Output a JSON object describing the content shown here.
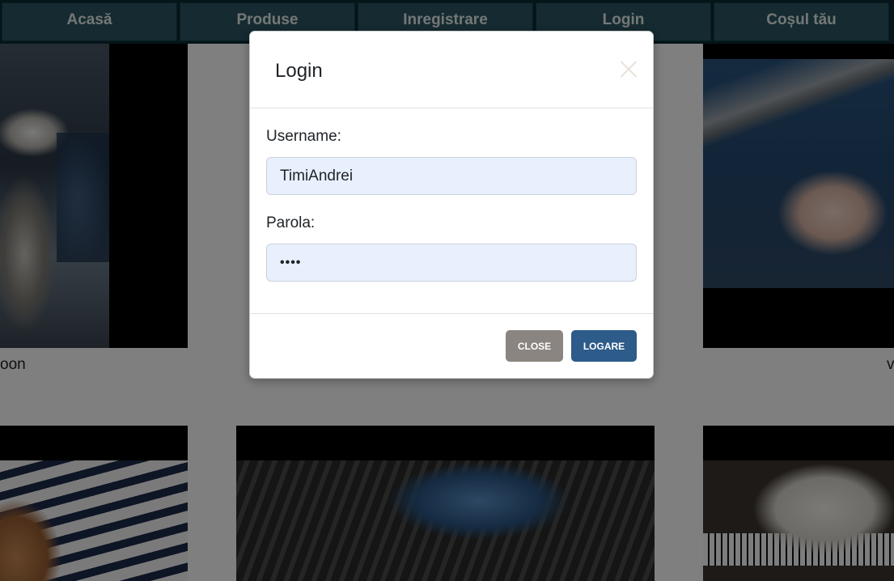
{
  "nav": {
    "items": [
      {
        "label": "Acasă"
      },
      {
        "label": "Produse"
      },
      {
        "label": "Inregistrare"
      },
      {
        "label": "Login"
      },
      {
        "label": "Coșul tău"
      }
    ]
  },
  "products": {
    "caption_left": "oon",
    "caption_right": "v"
  },
  "modal": {
    "title": "Login",
    "username_label": "Username:",
    "username_value": "TimiAndrei",
    "password_label": "Parola:",
    "password_value": "••••",
    "close_label": "CLOSE",
    "login_label": "LOGARE"
  }
}
